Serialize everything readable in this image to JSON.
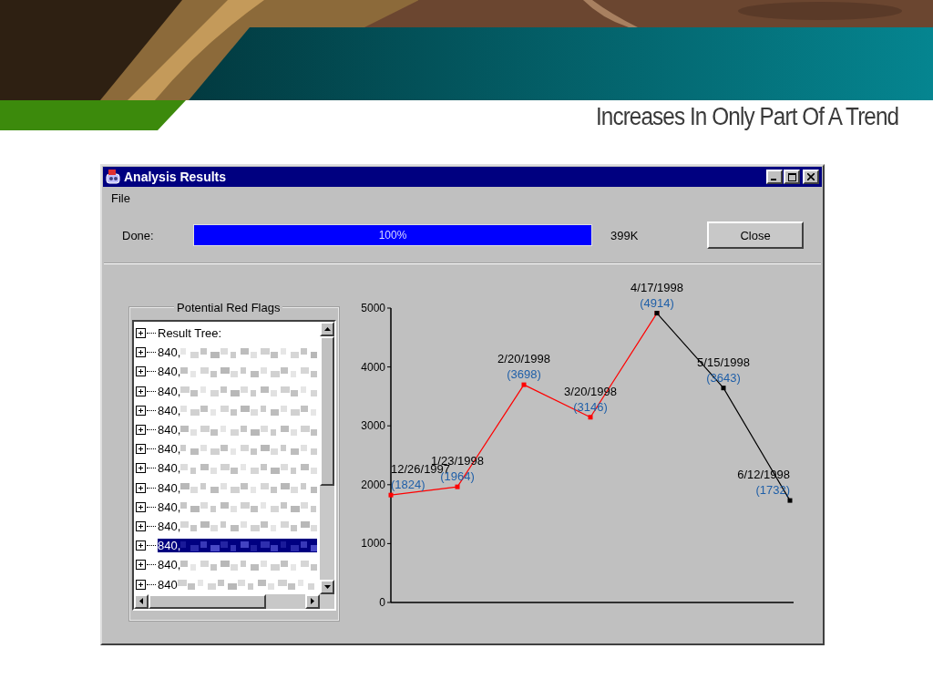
{
  "slide": {
    "title": "Increases In Only Part Of A Trend"
  },
  "window": {
    "title": "Analysis Results",
    "menu": [
      "File"
    ],
    "progress": {
      "label": "Done:",
      "level": 1,
      "text": "100%",
      "size": "399K"
    },
    "close_button": "Close",
    "tree": {
      "title": "Potential Red Flags",
      "root": "Result Tree:",
      "items": [
        {
          "label": "840,",
          "selected": false
        },
        {
          "label": "840,",
          "selected": false
        },
        {
          "label": "840,",
          "selected": false
        },
        {
          "label": "840,",
          "selected": false
        },
        {
          "label": "840,",
          "selected": false
        },
        {
          "label": "840,",
          "selected": false
        },
        {
          "label": "840,",
          "selected": false
        },
        {
          "label": "840,",
          "selected": false
        },
        {
          "label": "840,",
          "selected": false
        },
        {
          "label": "840,",
          "selected": false
        },
        {
          "label": "840,",
          "selected": true
        },
        {
          "label": "840,",
          "selected": false
        },
        {
          "label": "840",
          "selected": false
        }
      ]
    },
    "chart_data": {
      "type": "line",
      "categories": [
        "12/26/1997",
        "1/23/1998",
        "2/20/1998",
        "3/20/1998",
        "4/17/1998",
        "5/15/1998",
        "6/12/1998"
      ],
      "series": [
        {
          "color": "#ff0000",
          "marker": "square",
          "values": [
            1824,
            1964,
            3698,
            3146,
            4914,
            null,
            null
          ],
          "value_labels": [
            "(1824)",
            "(1964)",
            "(3698)",
            "(3146)",
            "(4914)",
            null,
            null
          ]
        },
        {
          "color": "#000000",
          "marker": "square",
          "values": [
            null,
            null,
            null,
            null,
            4914,
            3643,
            1732
          ],
          "value_labels": [
            null,
            null,
            null,
            null,
            null,
            "(3643)",
            "(1732)"
          ]
        }
      ],
      "ylim": [
        0,
        5000
      ],
      "yticks": [
        0,
        1000,
        2000,
        3000,
        4000,
        5000
      ]
    }
  }
}
